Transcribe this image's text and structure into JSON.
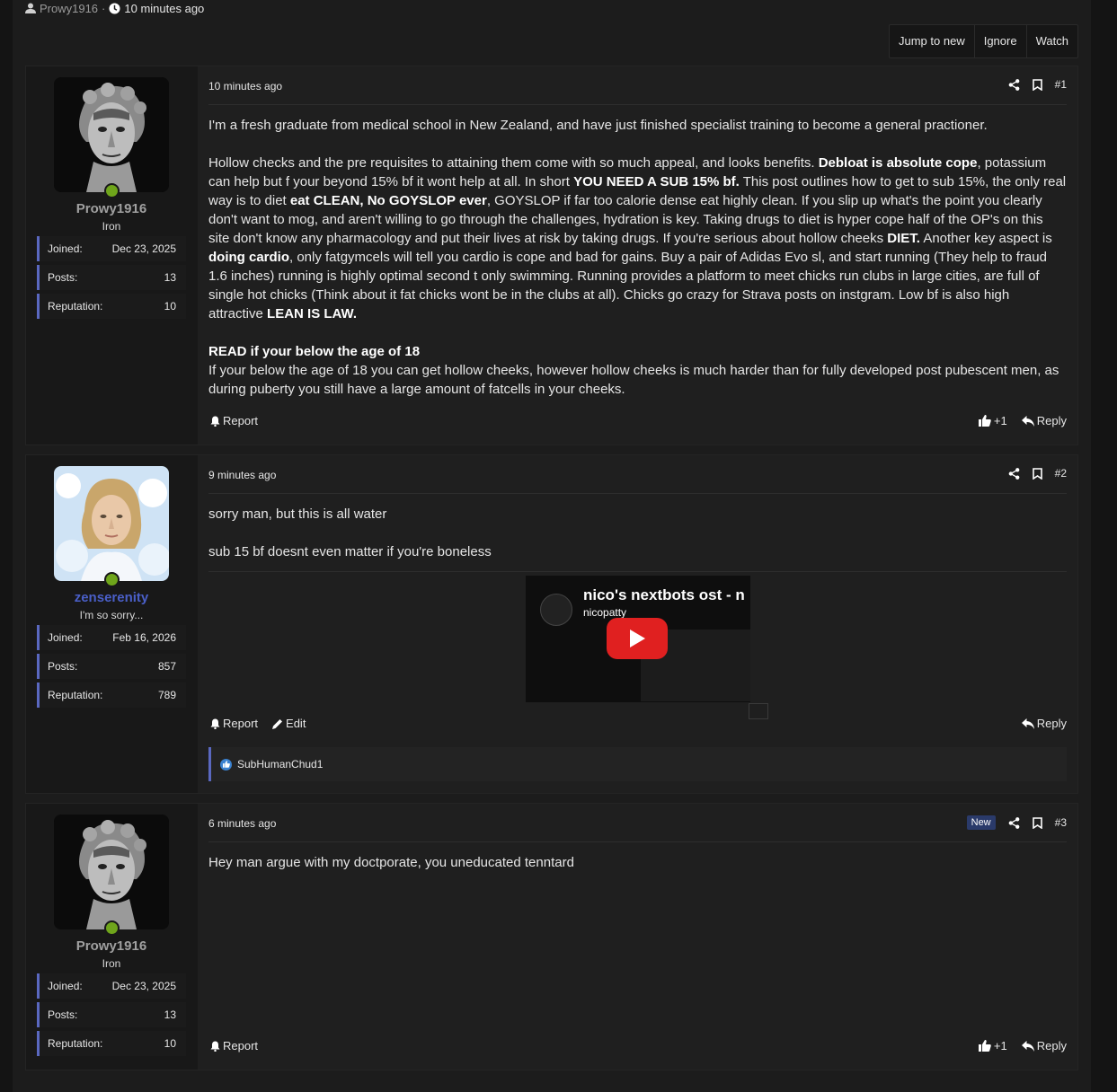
{
  "thread": {
    "author": "Prowy1916",
    "separator": "·",
    "time": "10 minutes ago"
  },
  "actions": {
    "jump_to_new": "Jump to new",
    "ignore": "Ignore",
    "watch": "Watch"
  },
  "labels": {
    "joined": "Joined:",
    "posts": "Posts:",
    "reputation": "Reputation:",
    "report": "Report",
    "edit": "Edit",
    "reply": "Reply",
    "new": "New"
  },
  "posts": [
    {
      "user": {
        "name": "Prowy1916",
        "title": "Iron",
        "joined": "Dec 23, 2025",
        "posts": "13",
        "reputation": "10"
      },
      "time": "10 minutes ago",
      "number": "#1",
      "likes": "+1",
      "p1": "I'm a fresh graduate from medical school in New Zealand, and have just finished specialist training to become a general practioner.",
      "p2a": "Hollow checks and the pre requisites to attaining them come with so much appeal, and looks benefits. ",
      "p2b": "Debloat is absolute cope",
      "p2c": ", potassium can help but f your beyond 15% bf it wont help at all. In short ",
      "p2d": "YOU NEED A SUB 15% bf.",
      "p2e": " This post outlines how to get to sub 15%, the only real way is to diet ",
      "p2f": "eat CLEAN, No GOYSLOP ever",
      "p2g": ", GOYSLOP if far too calorie dense eat highly clean. If you slip up what's the point you clearly don't want to mog, and aren't willing to go through the challenges, hydration is key. Taking drugs to diet is hyper cope half of the OP's on this site don't know any pharmacology and put their lives at risk by taking drugs. If you're serious about hollow cheeks ",
      "p2h": "DIET.",
      "p2i": " Another key aspect is ",
      "p2j": "doing cardio",
      "p2k": ", only fatgymcels will tell you cardio is cope and bad for gains. Buy a pair of Adidas Evo sl, and start running (They help to fraud 1.6 inches) running is highly optimal second t only swimming. Running provides a platform to meet chicks run clubs in large cities, are full of single hot chicks (Think about it fat chicks wont be in the clubs at all). Chicks go crazy for Strava posts on instgram. Low bf is also high attractive ",
      "p2l": "LEAN IS LAW.",
      "p3a": "READ if your below the age of 18",
      "p3b": "If your below the age of 18 you can get hollow cheeks, however hollow cheeks is much harder than for fully developed post pubescent men, as during puberty you still have a large amount of fatcells in your cheeks."
    },
    {
      "user": {
        "name": "zenserenity",
        "title": "I'm so sorry...",
        "joined": "Feb 16, 2026",
        "posts": "857",
        "reputation": "789"
      },
      "time": "9 minutes ago",
      "number": "#2",
      "p1": "sorry man, but this is all water",
      "p2": "sub 15 bf doesnt even matter if you're boneless",
      "video": {
        "title": "nico's nextbots ost - n",
        "channel": "nicopatty"
      },
      "liked_by": "SubHumanChud1"
    },
    {
      "user": {
        "name": "Prowy1916",
        "title": "Iron",
        "joined": "Dec 23, 2025",
        "posts": "13",
        "reputation": "10"
      },
      "time": "6 minutes ago",
      "number": "#3",
      "likes": "+1",
      "p1": "Hey man argue with my doctporate, you uneducated tenntard"
    }
  ],
  "colors": {
    "accent": "#5a68c0",
    "online": "#6fa51b",
    "username_highlight": "#4a5fc8",
    "background": "#1c1c1c"
  }
}
